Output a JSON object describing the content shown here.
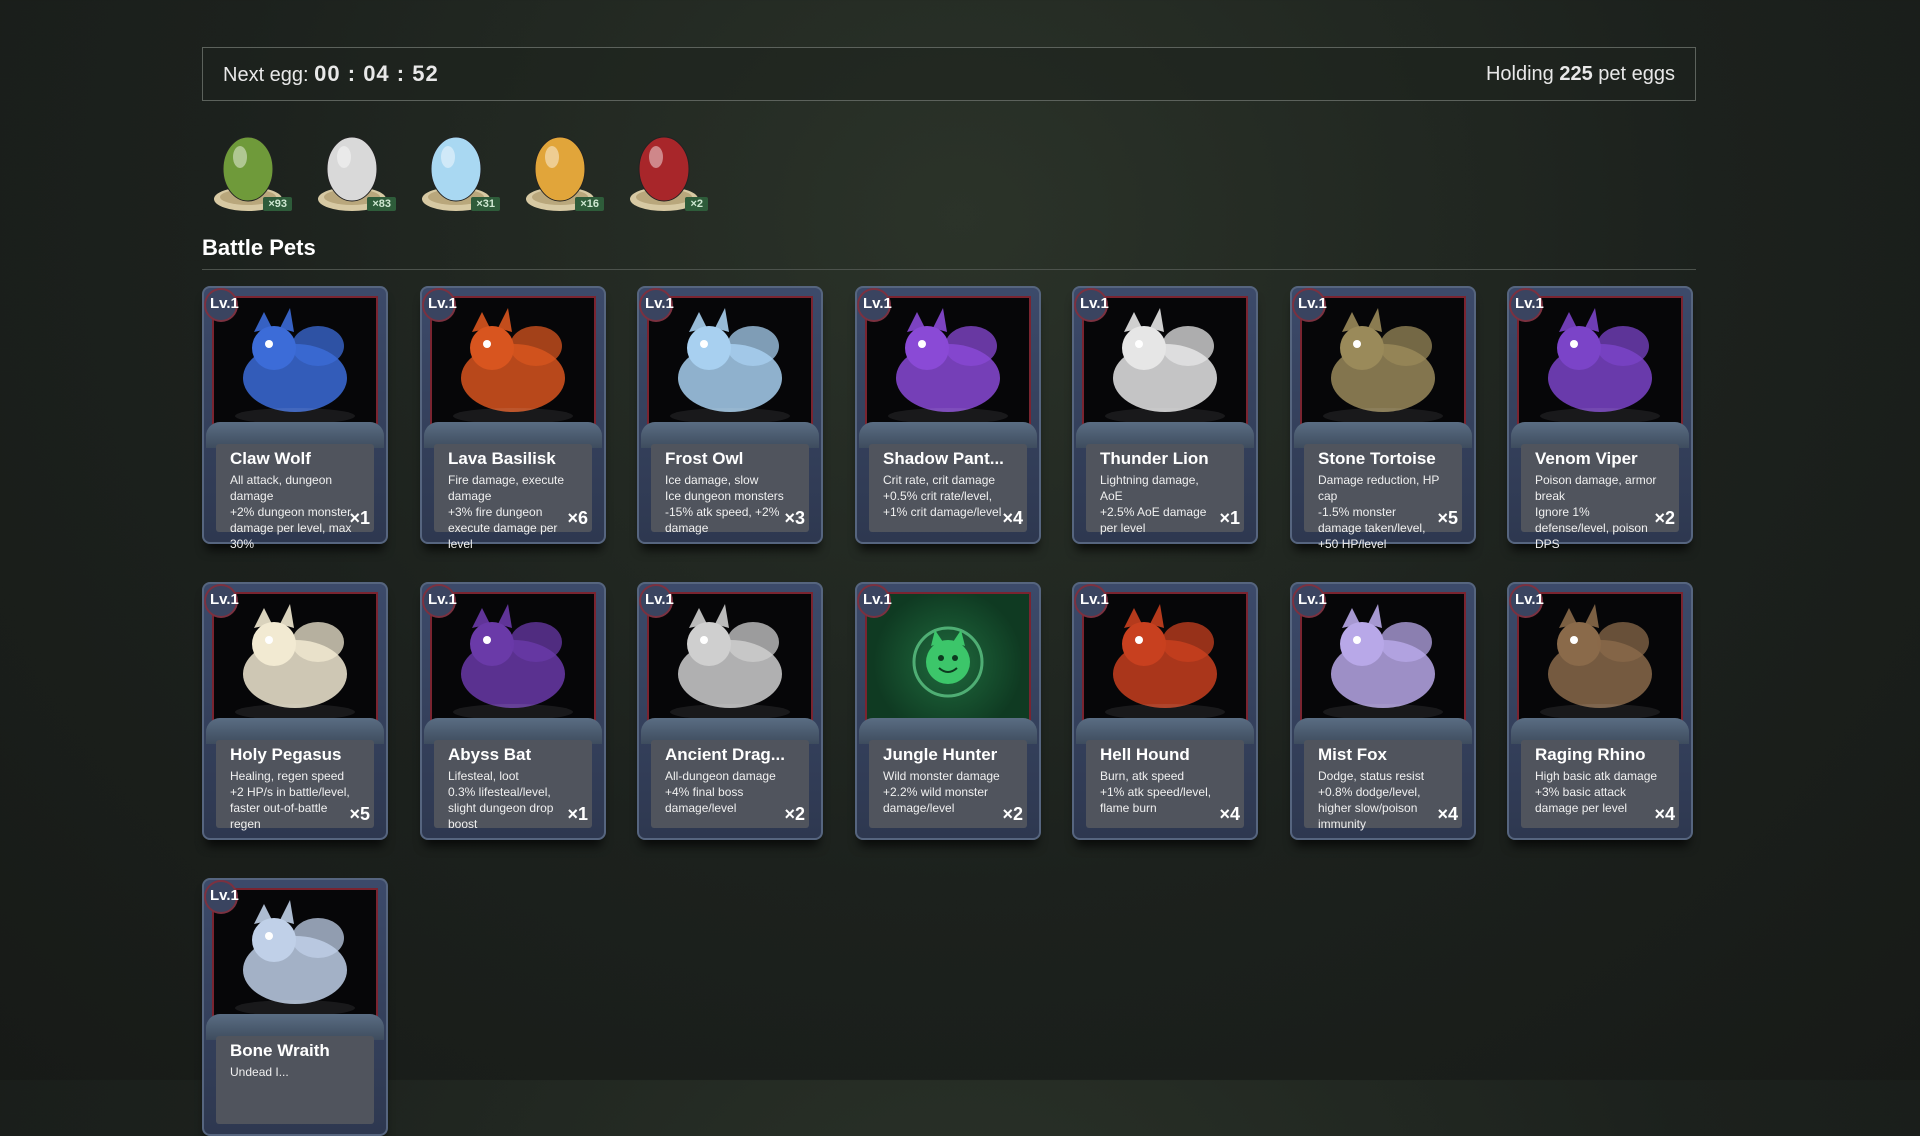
{
  "header": {
    "next_egg_label": "Next egg:",
    "timer": "00 : 04 : 52",
    "holding_prefix": "Holding",
    "holding_count": "225",
    "holding_suffix": "pet eggs"
  },
  "eggs": [
    {
      "name": "green-egg",
      "color": "#6f9a3a",
      "count": "×93"
    },
    {
      "name": "white-egg",
      "color": "#d9d9d9",
      "count": "×83"
    },
    {
      "name": "ice-egg",
      "color": "#a9d8f2",
      "count": "×31"
    },
    {
      "name": "gold-egg",
      "color": "#e1a53a",
      "count": "×16"
    },
    {
      "name": "red-egg",
      "color": "#a8262a",
      "count": "×2"
    }
  ],
  "section_title": "Battle Pets",
  "pets": [
    {
      "level": "Lv.1",
      "name": "Claw Wolf",
      "desc": "All attack, dungeon damage\n+2% dungeon monster damage per level, max 30%",
      "count": "×1",
      "icon": "blue-armored-wolf",
      "color": "#3c6cd8"
    },
    {
      "level": "Lv.1",
      "name": "Lava Basilisk",
      "desc": "Fire damage, execute damage\n+3% fire dungeon execute damage per level",
      "count": "×6",
      "icon": "fire-basilisk",
      "color": "#d8551f"
    },
    {
      "level": "Lv.1",
      "name": "Frost Owl",
      "desc": "Ice damage, slow\nIce dungeon monsters -15% atk speed, +2% damage",
      "count": "×3",
      "icon": "ice-owl",
      "color": "#a8d0f0"
    },
    {
      "level": "Lv.1",
      "name": "Shadow Pant...",
      "desc": "Crit rate, crit damage\n+0.5% crit rate/level, +1% crit damage/level",
      "count": "×4",
      "icon": "shadow-panther",
      "color": "#8a4ad6"
    },
    {
      "level": "Lv.1",
      "name": "Thunder Lion",
      "desc": "Lightning damage, AoE\n+2.5% AoE damage per level",
      "count": "×1",
      "icon": "white-lion",
      "color": "#e6e6e6"
    },
    {
      "level": "Lv.1",
      "name": "Stone Tortoise",
      "desc": "Damage reduction, HP cap\n-1.5% monster damage taken/level, +50 HP/level",
      "count": "×5",
      "icon": "stone-tortoise",
      "color": "#9a8a5a"
    },
    {
      "level": "Lv.1",
      "name": "Venom Viper",
      "desc": "Poison damage, armor break\nIgnore 1% defense/level, poison DPS",
      "count": "×2",
      "icon": "purple-viper",
      "color": "#7b44c8"
    },
    {
      "level": "Lv.1",
      "name": "Holy Pegasus",
      "desc": "Healing, regen speed\n+2 HP/s in battle/level, faster out-of-battle regen",
      "count": "×5",
      "icon": "pegasus",
      "color": "#f2ead2"
    },
    {
      "level": "Lv.1",
      "name": "Abyss Bat",
      "desc": "Lifesteal, loot\n0.3% lifesteal/level, slight dungeon drop boost",
      "count": "×1",
      "icon": "abyss-bat",
      "color": "#6a3aa8"
    },
    {
      "level": "Lv.1",
      "name": "Ancient Drag...",
      "desc": "All-dungeon damage\n+4% final boss damage/level",
      "count": "×2",
      "icon": "bone-dragon",
      "color": "#cfcfcf"
    },
    {
      "level": "Lv.1",
      "name": "Jungle Hunter",
      "desc": "Wild monster damage\n+2.2% wild monster damage/level",
      "count": "×2",
      "icon": "smiley-placeholder",
      "color": "#3cc66a",
      "placeholder": true
    },
    {
      "level": "Lv.1",
      "name": "Hell Hound",
      "desc": "Burn, atk speed\n+1% atk speed/level, flame burn",
      "count": "×4",
      "icon": "hell-hound",
      "color": "#c8401f"
    },
    {
      "level": "Lv.1",
      "name": "Mist Fox",
      "desc": "Dodge, status resist\n+0.8% dodge/level, higher slow/poison immunity",
      "count": "×4",
      "icon": "mist-fox",
      "color": "#b8a8e8"
    },
    {
      "level": "Lv.1",
      "name": "Raging Rhino",
      "desc": "High basic atk damage\n+3% basic attack damage per level",
      "count": "×4",
      "icon": "rhino",
      "color": "#8a6a4a"
    },
    {
      "level": "Lv.1",
      "name": "Bone Wraith",
      "desc": "Undead I...",
      "count": "",
      "icon": "bone-wraith",
      "color": "#c0d0e8"
    }
  ]
}
